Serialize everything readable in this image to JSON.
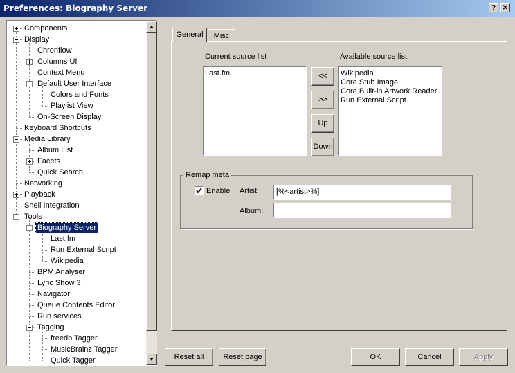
{
  "window": {
    "title": "Preferences: Biography Server",
    "help_button": "?",
    "close_button": "✕"
  },
  "tree": {
    "items": [
      {
        "label": "Components"
      },
      {
        "label": "Display"
      },
      {
        "label": "Chronflow"
      },
      {
        "label": "Columns UI"
      },
      {
        "label": "Context Menu"
      },
      {
        "label": "Default User Interface"
      },
      {
        "label": "Colors and Fonts"
      },
      {
        "label": "Playlist View"
      },
      {
        "label": "On-Screen Display"
      },
      {
        "label": "Keyboard Shortcuts"
      },
      {
        "label": "Media Library"
      },
      {
        "label": "Album List"
      },
      {
        "label": "Facets"
      },
      {
        "label": "Quick Search"
      },
      {
        "label": "Networking"
      },
      {
        "label": "Playback"
      },
      {
        "label": "Shell Integration"
      },
      {
        "label": "Tools"
      },
      {
        "label": "Biography Server"
      },
      {
        "label": "Last.fm"
      },
      {
        "label": "Run External Script"
      },
      {
        "label": "Wikipedia"
      },
      {
        "label": "BPM Analyser"
      },
      {
        "label": "Lyric Show 3"
      },
      {
        "label": "Navigator"
      },
      {
        "label": "Queue Contents Editor"
      },
      {
        "label": "Run services"
      },
      {
        "label": "Tagging"
      },
      {
        "label": "freedb Tagger"
      },
      {
        "label": "MusicBrainz Tagger"
      },
      {
        "label": "Quick Tagger"
      }
    ],
    "selected": "Biography Server"
  },
  "tabs": {
    "general": "General",
    "misc": "Misc",
    "active": "General"
  },
  "sources": {
    "current_label": "Current source list",
    "available_label": "Available source list",
    "current_items": [
      "Last.fm"
    ],
    "available_items": [
      "Wikipedia",
      "Core Stub Image",
      "Core Built-in Artwork Reader",
      "Run External Script"
    ],
    "btn_add": "<<",
    "btn_remove": ">>",
    "btn_up": "Up",
    "btn_down": "Down"
  },
  "remap": {
    "group_label": "Remap meta",
    "enable_label": "Enable",
    "enable_checked": true,
    "artist_label": "Artist:",
    "artist_value": "[%<artist>%]",
    "album_label": "Album:",
    "album_value": ""
  },
  "footer": {
    "reset_all": "Reset all",
    "reset_page": "Reset page",
    "ok": "OK",
    "cancel": "Cancel",
    "apply": "Apply"
  }
}
